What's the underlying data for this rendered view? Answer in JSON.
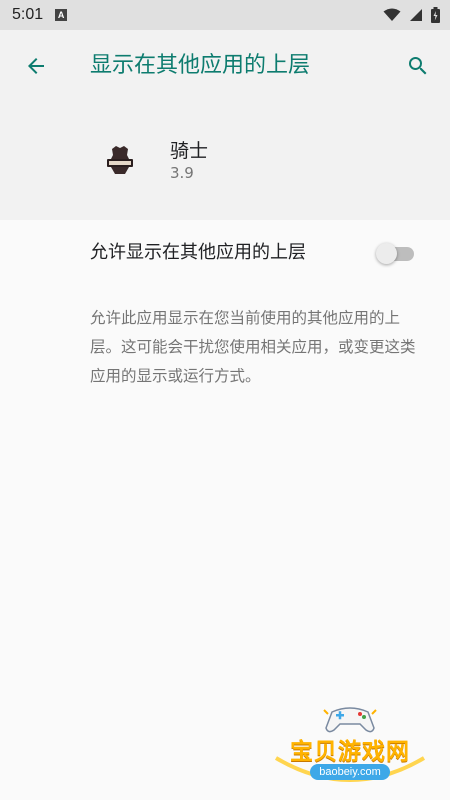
{
  "status_bar": {
    "time": "5:01",
    "notification_icon": "a-badge-icon",
    "wifi_icon": "wifi-icon",
    "signal_icon": "signal-icon",
    "battery_icon": "battery-icon"
  },
  "app_bar": {
    "title": "显示在其他应用的上层",
    "back_icon": "arrow-left-icon",
    "search_icon": "search-icon"
  },
  "app": {
    "name": "骑士",
    "version": "3.9",
    "icon": "app-icon"
  },
  "setting": {
    "label": "允许显示在其他应用的上层",
    "enabled": false
  },
  "description": "允许此应用显示在您当前使用的其他应用的上层。这可能会干扰您使用相关应用，或变更这类应用的显示或运行方式。",
  "watermark": {
    "text": "宝贝游戏网",
    "domain": "baobeiy.com"
  },
  "colors": {
    "accent": "#0d7c6f",
    "app_bar_bg": "#f2f2f2",
    "status_bar_bg": "#e0e0e0",
    "background": "#fafafa",
    "secondary_text": "#757575"
  }
}
